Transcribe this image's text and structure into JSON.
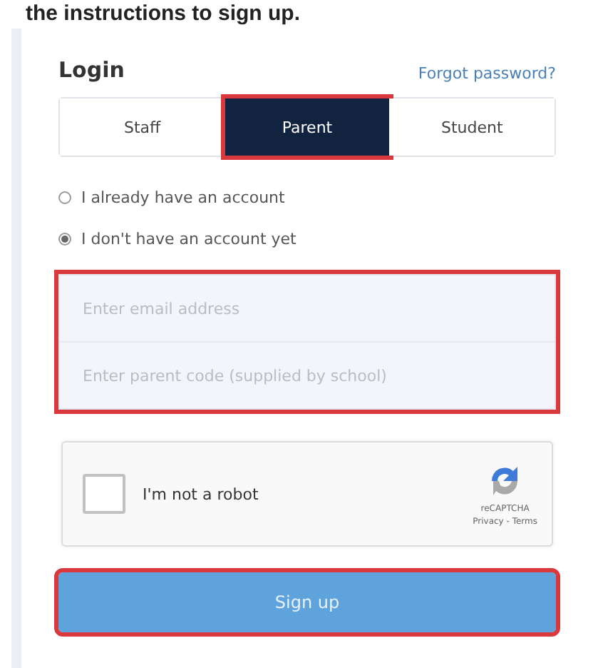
{
  "caption": "the instructions to sign up.",
  "login": {
    "title": "Login",
    "forgot_link": "Forgot password?"
  },
  "tabs": [
    {
      "label": "Staff",
      "selected": false,
      "highlighted": false
    },
    {
      "label": "Parent",
      "selected": true,
      "highlighted": true
    },
    {
      "label": "Student",
      "selected": false,
      "highlighted": false
    }
  ],
  "account_options": [
    {
      "label": "I already have an account",
      "selected": false
    },
    {
      "label": "I don't have an account yet",
      "selected": true
    }
  ],
  "fields": {
    "highlighted": true,
    "items": [
      {
        "placeholder": "Enter email address"
      },
      {
        "placeholder": "Enter parent code (supplied by school)"
      }
    ]
  },
  "captcha": {
    "label": "I'm not a robot",
    "checked": false,
    "brand": "reCAPTCHA",
    "links": "Privacy - Terms"
  },
  "submit": {
    "label": "Sign up",
    "highlighted": true
  }
}
